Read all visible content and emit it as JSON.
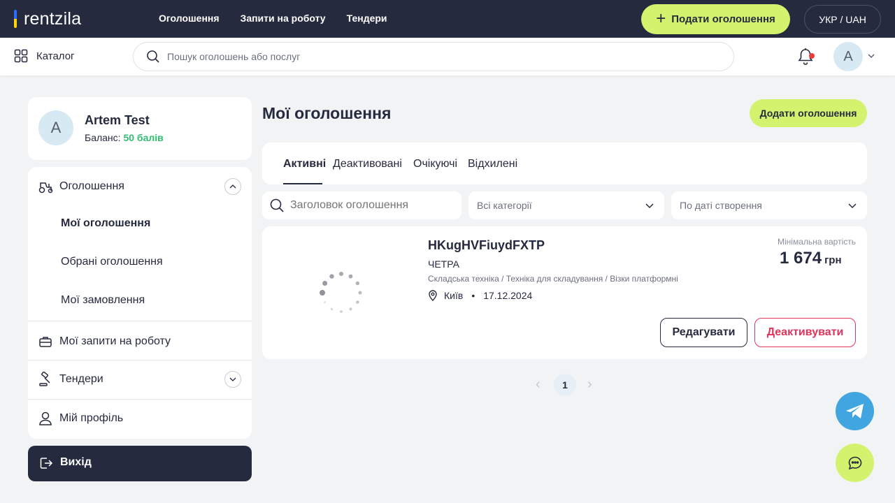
{
  "brand": {
    "logo_text": "rentzila"
  },
  "topnav": {
    "links": [
      "Оголошення",
      "Запити на роботу",
      "Тендери"
    ],
    "post_ad_label": "Подати оголошення",
    "lang_label": "УКР / UAH"
  },
  "subbar": {
    "catalog_label": "Каталог",
    "search_placeholder": "Пошук оголошень або послуг",
    "avatar_letter": "A"
  },
  "profile": {
    "avatar_letter": "A",
    "name": "Artem Test",
    "balance_label": "Баланс:",
    "balance_value": "50 балів"
  },
  "sidebar": {
    "ads_label": "Оголошення",
    "sub_items": [
      "Мої оголошення",
      "Обрані оголошення",
      "Мої замовлення"
    ],
    "work_requests_label": "Мої запити на роботу",
    "tenders_label": "Тендери",
    "profile_label": "Мій профіль",
    "logout_label": "Вихід"
  },
  "main": {
    "title": "Мої оголошення",
    "add_button": "Додати оголошення",
    "tabs": [
      "Активні",
      "Деактивовані",
      "Очікуючі",
      "Відхилені"
    ],
    "active_tab": "Активні",
    "search_placeholder": "Заголовок оголошення",
    "category_filter": "Всі категорії",
    "sort_filter": "По даті створення"
  },
  "listing": {
    "title": "HKugHVFiuydFXTP",
    "brand": "ЧЕТРА",
    "category_path": "Складська техніка / Техніка для складування / Візки платформні",
    "city": "Київ",
    "date": "17.12.2024",
    "min_price_label": "Мінімальна вартість",
    "price": "1 674",
    "currency": "грн",
    "edit_label": "Редагувати",
    "deactivate_label": "Деактивувати"
  },
  "pagination": {
    "prev": "‹",
    "current": "1",
    "next": "›"
  },
  "colors": {
    "dark": "#252a3f",
    "accent": "#d3f26e",
    "green": "#2fbf71",
    "red": "#e2345a",
    "telegram": "#41a6e0"
  },
  "icons": [
    "catalog-grid-icon",
    "search-icon",
    "bell-icon",
    "chevron-down-icon",
    "tractor-icon",
    "briefcase-icon",
    "gavel-icon",
    "user-icon",
    "logout-icon",
    "location-pin-icon",
    "telegram-icon",
    "chat-icon",
    "loading-spinner-icon"
  ]
}
